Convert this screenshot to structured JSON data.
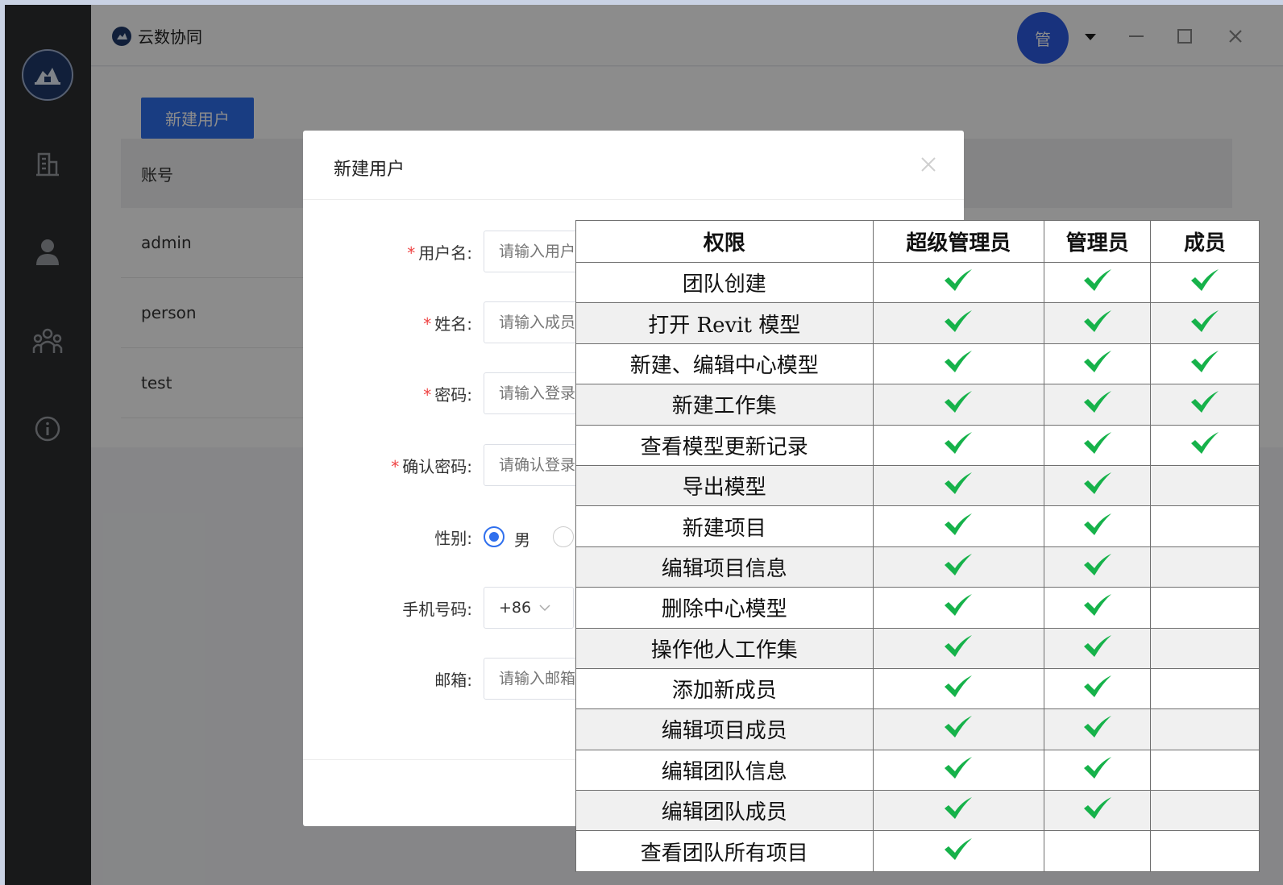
{
  "app": {
    "title": "云数协同",
    "avatar_text": "管"
  },
  "content": {
    "new_user_button": "新建用户",
    "table_header": "账号",
    "users": [
      "admin",
      "person",
      "test"
    ]
  },
  "dialog": {
    "title": "新建用户",
    "fields": {
      "username": {
        "label": "用户名",
        "placeholder": "请输入用户"
      },
      "name": {
        "label": "姓名",
        "placeholder": "请输入成员"
      },
      "password": {
        "label": "密码",
        "placeholder": "请输入登录"
      },
      "confirm": {
        "label": "确认密码",
        "placeholder": "请确认登录"
      },
      "gender": {
        "label": "性别",
        "option_male": "男"
      },
      "phone": {
        "label": "手机号码",
        "country_code": "+86"
      },
      "email": {
        "label": "邮箱",
        "placeholder": "请输入邮箱"
      }
    }
  },
  "permissions": {
    "headers": [
      "权限",
      "超级管理员",
      "管理员",
      "成员"
    ],
    "check_color": "#16b24a",
    "rows": [
      {
        "name": "团队创建",
        "super": true,
        "admin": true,
        "member": true
      },
      {
        "name": "打开 Revit 模型",
        "super": true,
        "admin": true,
        "member": true
      },
      {
        "name": "新建、编辑中心模型",
        "super": true,
        "admin": true,
        "member": true
      },
      {
        "name": "新建工作集",
        "super": true,
        "admin": true,
        "member": true
      },
      {
        "name": "查看模型更新记录",
        "super": true,
        "admin": true,
        "member": true
      },
      {
        "name": "导出模型",
        "super": true,
        "admin": true,
        "member": false
      },
      {
        "name": "新建项目",
        "super": true,
        "admin": true,
        "member": false
      },
      {
        "name": "编辑项目信息",
        "super": true,
        "admin": true,
        "member": false
      },
      {
        "name": "删除中心模型",
        "super": true,
        "admin": true,
        "member": false
      },
      {
        "name": "操作他人工作集",
        "super": true,
        "admin": true,
        "member": false
      },
      {
        "name": "添加新成员",
        "super": true,
        "admin": true,
        "member": false
      },
      {
        "name": "编辑项目成员",
        "super": true,
        "admin": true,
        "member": false
      },
      {
        "name": "编辑团队信息",
        "super": true,
        "admin": true,
        "member": false
      },
      {
        "name": "编辑团队成员",
        "super": true,
        "admin": true,
        "member": false
      },
      {
        "name": "查看团队所有项目",
        "super": true,
        "admin": false,
        "member": false
      }
    ]
  }
}
